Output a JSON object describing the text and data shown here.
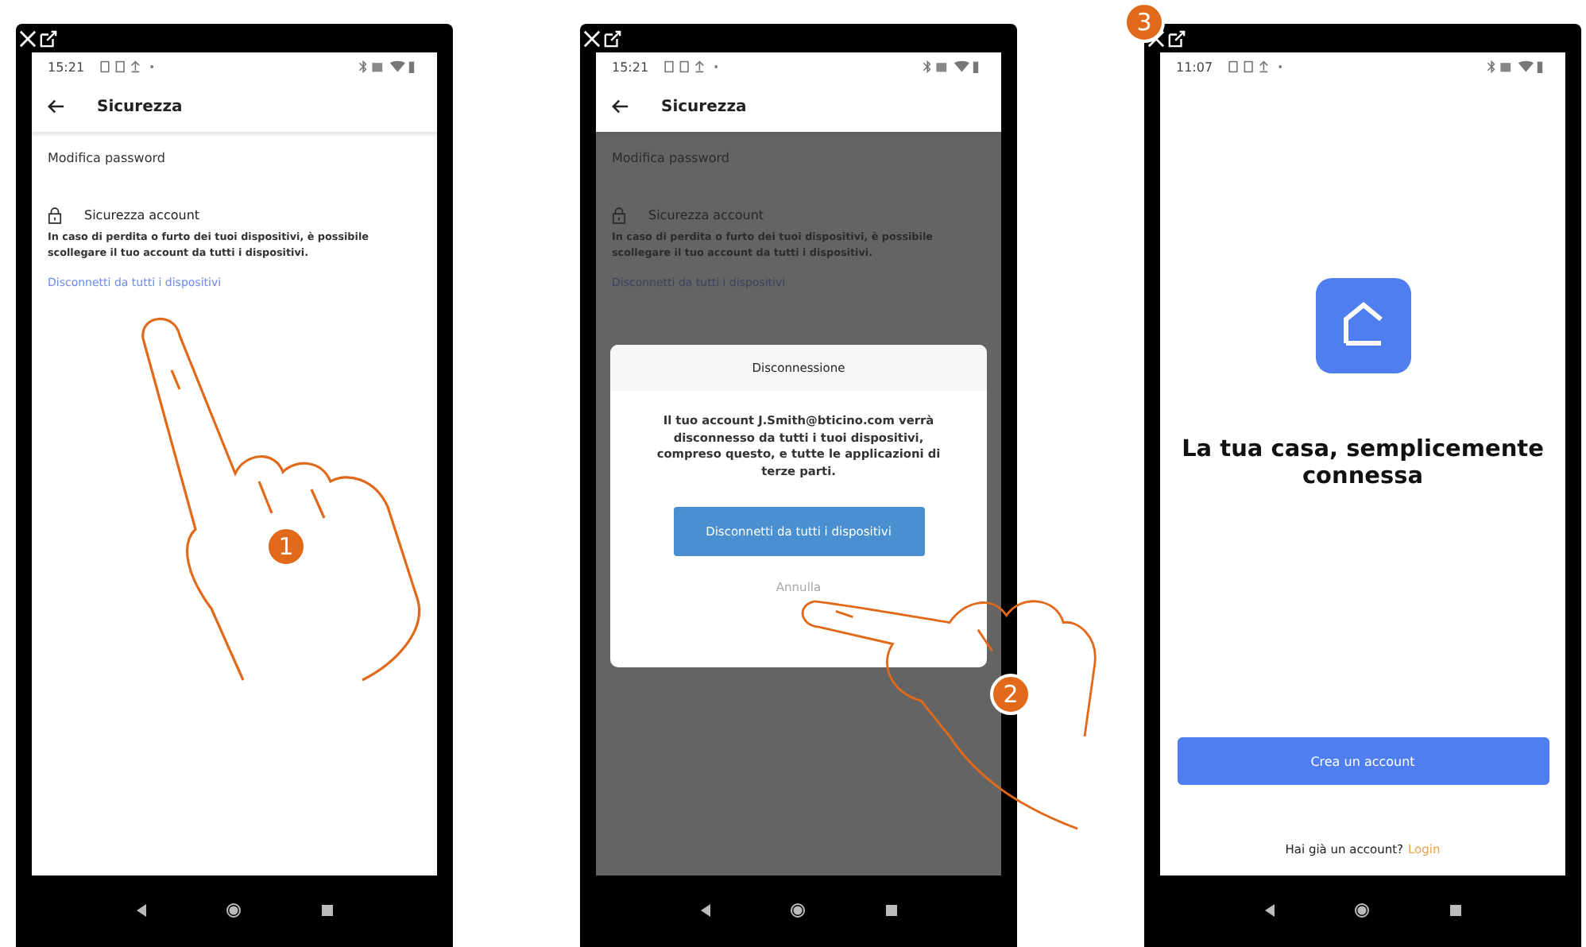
{
  "phones": [
    {
      "kind": "security",
      "step": "1",
      "time": "15:21",
      "dimmed": false,
      "title": "Sicurezza",
      "change_password": "Modifica password",
      "section_title": "Sicurezza account",
      "description": "In caso di perdita o furto dei tuoi dispositivi, è possibile scollegare il tuo account da tutti i dispositivi.",
      "link": "Disconnetti da tutti i dispositivi"
    },
    {
      "kind": "security",
      "step": "2",
      "time": "15:21",
      "dimmed": true,
      "title": "Sicurezza",
      "change_password": "Modifica password",
      "section_title": "Sicurezza account",
      "description": "In caso di perdita o furto dei tuoi dispositivi, è possibile scollegare il tuo account da tutti i dispositivi.",
      "link": "Disconnetti da tutti i dispositivi",
      "dialog": {
        "title": "Disconnessione",
        "message": "Il tuo account J.Smith@bticino.com verrà disconnesso da tutti i tuoi dispositivi, compreso questo, e tutte le applicazioni di terze parti.",
        "confirm": "Disconnetti da tutti i dispositivi",
        "cancel": "Annulla"
      }
    },
    {
      "kind": "welcome",
      "step": "3",
      "time": "11:07",
      "headline": "La tua casa, semplicemente connessa",
      "create_button": "Crea un account",
      "login_prompt": "Hai già un account?",
      "login_link": "Login"
    }
  ]
}
